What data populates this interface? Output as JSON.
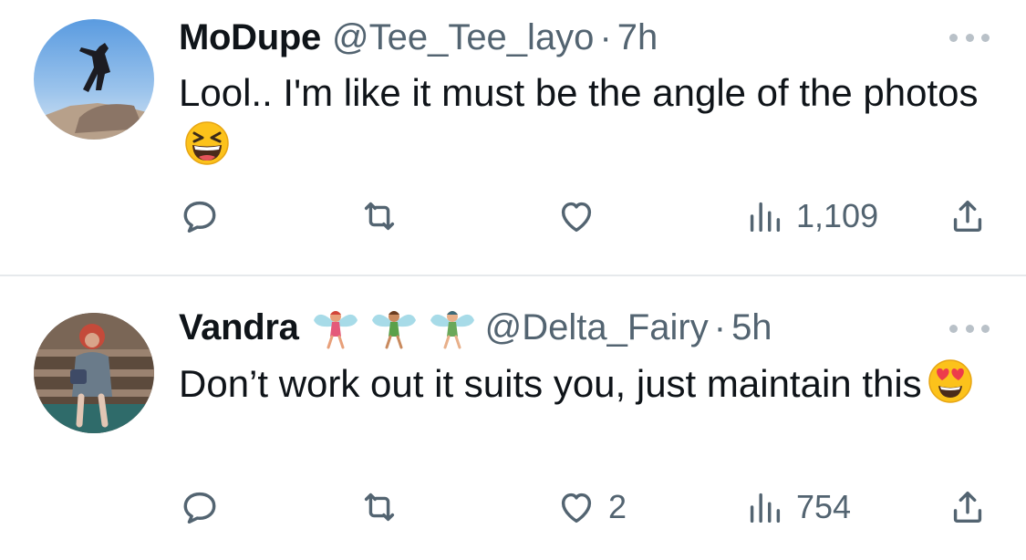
{
  "tweets": [
    {
      "name": "MoDupe",
      "handle": "@Tee_Tee_layo",
      "separator": "·",
      "time": "7h",
      "text": "Lool.. I'm like it must be the angle of the photos",
      "text_emoji": "laughing-squinting-face-emoji",
      "likes": "",
      "views": "1,109"
    },
    {
      "name": "Vandra",
      "name_emojis": [
        "fairy-emoji",
        "fairy-emoji",
        "fairy-emoji"
      ],
      "handle": "@Delta_Fairy",
      "separator": "·",
      "time": "5h",
      "text": "Don’t work out it suits you, just maintain this",
      "text_emoji": "heart-eyes-face-emoji",
      "likes": "2",
      "views": "754"
    }
  ],
  "colors": {
    "text": "#0f1419",
    "secondary": "#536471",
    "divider": "#e6e9ec",
    "more_dots": "#b9c1c8"
  },
  "icons": {
    "reply": "reply-icon",
    "retweet": "retweet-icon",
    "like": "heart-icon",
    "views": "views-icon",
    "share": "share-icon",
    "more": "more-icon"
  }
}
